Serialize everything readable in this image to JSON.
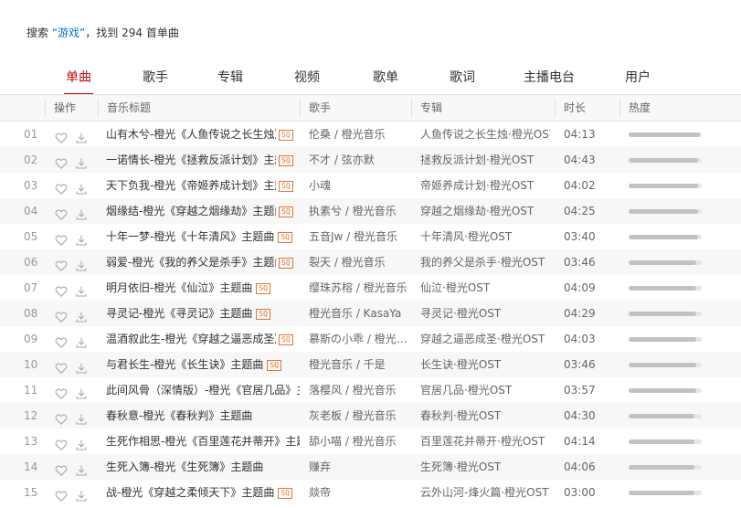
{
  "search": {
    "prefix": "搜索",
    "keyword": "“游戏”",
    "suffix": "，找到 294 首单曲"
  },
  "tabs": [
    {
      "label": "单曲",
      "active": true
    },
    {
      "label": "歌手"
    },
    {
      "label": "专辑"
    },
    {
      "label": "视频"
    },
    {
      "label": "歌单"
    },
    {
      "label": "歌词"
    },
    {
      "label": "主播电台"
    },
    {
      "label": "用户"
    }
  ],
  "columns": {
    "ops": "操作",
    "title": "音乐标题",
    "artist": "歌手",
    "album": "专辑",
    "duration": "时长",
    "hot": "热度"
  },
  "colors": {
    "accent": "#c20c0c",
    "sq": "#e57631"
  },
  "rows": [
    {
      "num": "01",
      "title": "山有木兮-橙光《人鱼传说之长生烛》主题曲",
      "sq": "SQ",
      "artist": "伦桑 / 橙光音乐",
      "album": "人鱼传说之长生烛·橙光OST",
      "duration": "04:13",
      "hot": 0.98
    },
    {
      "num": "02",
      "title": "一诺情长-橙光《拯救反派计划》主题曲",
      "sq": "SQ",
      "artist": "不才 / 弦亦默",
      "album": "拯救反派计划·橙光OST",
      "duration": "04:43",
      "hot": 0.95
    },
    {
      "num": "03",
      "title": "天下负我-橙光《帝姬养成计划》主题曲",
      "sq": "SQ",
      "artist": "小魂",
      "album": "帝姬养成计划·橙光OST",
      "duration": "04:02",
      "hot": 0.95
    },
    {
      "num": "04",
      "title": "烟缘结-橙光《穿越之烟缘劫》主题曲",
      "sq": "SQ",
      "artist": "执素兮 / 橙光音乐",
      "album": "穿越之烟缘劫·橙光OST",
      "duration": "04:25",
      "hot": 0.95
    },
    {
      "num": "05",
      "title": "十年一梦-橙光《十年清风》主题曲",
      "sq": "SQ",
      "artist": "五音Jw / 橙光音乐",
      "album": "十年清风·橙光OST",
      "duration": "03:40",
      "hot": 0.95
    },
    {
      "num": "06",
      "title": "弱爱-橙光《我的养父是杀手》主题曲",
      "sq": "SQ",
      "artist": "裂天 / 橙光音乐",
      "album": "我的养父是杀手·橙光OST",
      "duration": "03:46",
      "hot": 0.93
    },
    {
      "num": "07",
      "title": "明月依旧-橙光《仙泣》主题曲",
      "sq": "SQ",
      "artist": "缨珠苏榕 / 橙光音乐",
      "album": "仙泣·橙光OST",
      "duration": "04:09",
      "hot": 0.93
    },
    {
      "num": "08",
      "title": "寻灵记-橙光《寻灵记》主题曲",
      "sq": "SQ",
      "artist": "橙光音乐 / KasaYa",
      "album": "寻灵记·橙光OST",
      "duration": "04:29",
      "hot": 0.93
    },
    {
      "num": "09",
      "title": "温酒叙此生-橙光《穿越之逼恶成圣》主题曲",
      "sq": "SQ",
      "artist": "慕斯の小乖 / 橙光音乐",
      "album": "穿越之逼恶成圣·橙光OST",
      "duration": "04:03",
      "hot": 0.93
    },
    {
      "num": "10",
      "title": "与君长生-橙光《长生诀》主题曲",
      "sq": "SQ",
      "artist": "橙光音乐 / 千是",
      "album": "长生诀·橙光OST",
      "duration": "03:46",
      "hot": 0.93
    },
    {
      "num": "11",
      "title": "此间风骨（深情版）-橙光《官居几品》主题曲",
      "sq": "",
      "artist": "落樱风 / 橙光音乐",
      "album": "官居几品·橙光OST",
      "duration": "03:57",
      "hot": 0.93
    },
    {
      "num": "12",
      "title": "春秋意-橙光《春秋判》主题曲",
      "sq": "",
      "artist": "灰老板 / 橙光音乐",
      "album": "春秋判·橙光OST",
      "duration": "04:30",
      "hot": 0.9
    },
    {
      "num": "13",
      "title": "生死作相思-橙光《百里莲花并蒂开》主题曲",
      "sq": "",
      "artist": "舔小喵 / 橙光音乐",
      "album": "百里莲花并蒂开·橙光OST",
      "duration": "04:14",
      "hot": 0.9
    },
    {
      "num": "14",
      "title": "生死入簿-橙光《生死簿》主题曲",
      "sq": "",
      "artist": "赚弃",
      "album": "生死簿·橙光OST",
      "duration": "04:06",
      "hot": 0.9
    },
    {
      "num": "15",
      "title": "战-橙光《穿越之柔倾天下》主题曲",
      "sq": "SQ",
      "artist": "燚帝",
      "album": "云外山河-烽火篇·橙光OST",
      "duration": "03:00",
      "hot": 0.9
    }
  ]
}
